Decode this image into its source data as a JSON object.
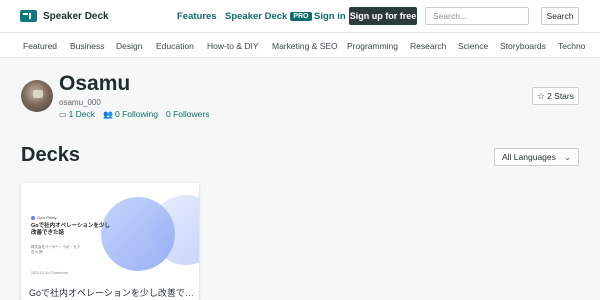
{
  "header": {
    "brand": "Speaker Deck",
    "nav": {
      "features": "Features",
      "speakerdeck": "Speaker Deck",
      "pro_badge": "PRO",
      "signin": "Sign in"
    },
    "signup_label": "Sign up for free",
    "search_placeholder": "Search...",
    "search_button": "Search"
  },
  "categories": [
    "Featured",
    "Business",
    "Design",
    "Education",
    "How-to & DIY",
    "Marketing & SEO",
    "Programming",
    "Research",
    "Science",
    "Storyboards",
    "Techno"
  ],
  "profile": {
    "name": "Osamu",
    "handle": "osamu_000",
    "decks": "1 Deck",
    "following": "0 Following",
    "followers": "0 Followers",
    "stars": "2 Stars"
  },
  "decks_section": {
    "title": "Decks",
    "language_filter": "All Languages"
  },
  "deck": {
    "title": "Goで社内オペレーションを少し改善できた...",
    "slide": {
      "brand": "Go's Pretty",
      "title": "Goで社内オペレーションを少し改善できた話",
      "meta_line1": "株式会社ベーター・ラボ・オプ",
      "meta_line2": "石川 修",
      "footer": "2023.10 Go Conference"
    }
  },
  "colors": {
    "accent": "#0f6d6d",
    "dark_button": "#2b3a3a",
    "background": "#f6f7f7"
  }
}
